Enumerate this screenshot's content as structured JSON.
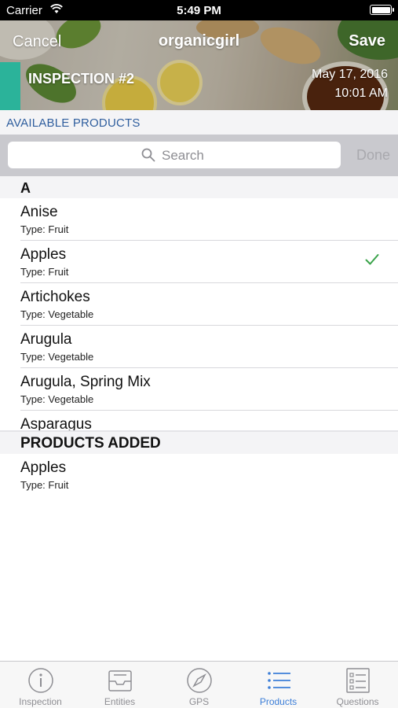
{
  "status_bar": {
    "carrier": "Carrier",
    "time": "5:49 PM"
  },
  "header": {
    "cancel_label": "Cancel",
    "title": "organicgirl",
    "save_label": "Save",
    "inspection_title": "INSPECTION #2",
    "date": "May 17, 2016",
    "time": "10:01 AM",
    "accent_color": "#2bb39a"
  },
  "available": {
    "heading": "AVAILABLE PRODUCTS",
    "search_placeholder": "Search",
    "done_label": "Done",
    "section_letter": "A",
    "items": [
      {
        "name": "Anise",
        "type": "Type: Fruit",
        "checked": false
      },
      {
        "name": "Apples",
        "type": "Type: Fruit",
        "checked": true
      },
      {
        "name": "Artichokes",
        "type": "Type: Vegetable",
        "checked": false
      },
      {
        "name": "Arugula",
        "type": "Type: Vegetable",
        "checked": false
      },
      {
        "name": "Arugula, Spring Mix",
        "type": "Type: Vegetable",
        "checked": false
      },
      {
        "name": "Asparagus",
        "type": "",
        "checked": false
      }
    ]
  },
  "added": {
    "heading": "PRODUCTS ADDED",
    "items": [
      {
        "name": "Apples",
        "type": "Type: Fruit"
      }
    ]
  },
  "tabs": [
    {
      "label": "Inspection",
      "icon": "info-icon",
      "active": false
    },
    {
      "label": "Entities",
      "icon": "inbox-icon",
      "active": false
    },
    {
      "label": "GPS",
      "icon": "compass-icon",
      "active": false
    },
    {
      "label": "Products",
      "icon": "list-icon",
      "active": true
    },
    {
      "label": "Questions",
      "icon": "checklist-icon",
      "active": false
    }
  ],
  "colors": {
    "accent": "#2bb39a",
    "link_blue": "#2f5e9e",
    "tab_active": "#3d7fd8",
    "check_green": "#3aa34a"
  }
}
